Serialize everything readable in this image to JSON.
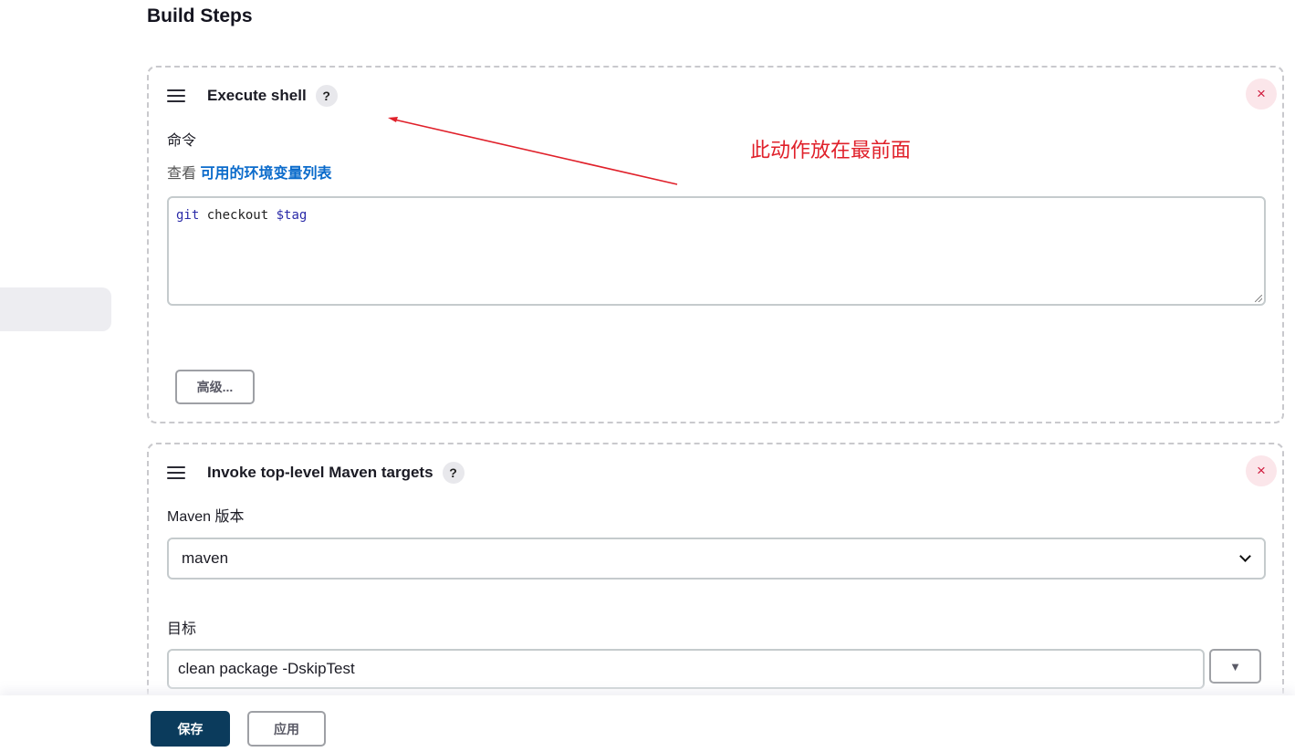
{
  "section_title": "Build Steps",
  "steps": [
    {
      "title": "Execute shell",
      "help": "?",
      "close": "×",
      "command_label": "命令",
      "env_prefix": "查看",
      "env_link": "可用的环境变量列表",
      "command": {
        "kw1": "git",
        "plain": " checkout ",
        "kw2": "$tag"
      },
      "advanced_button": "高级..."
    },
    {
      "title": "Invoke top-level Maven targets",
      "help": "?",
      "close": "×",
      "maven_version_label": "Maven 版本",
      "maven_version_selected": "maven",
      "goals_label": "目标",
      "goals_value": "clean package -DskipTest",
      "expand_icon": "▼"
    }
  ],
  "footer": {
    "save": "保存",
    "apply": "应用"
  },
  "annotation": {
    "text": "此动作放在最前面",
    "color": "#e0202a"
  },
  "colors": {
    "primary": "#0b3b5c",
    "link": "#0b6bcb",
    "danger": "#d01c3e"
  }
}
